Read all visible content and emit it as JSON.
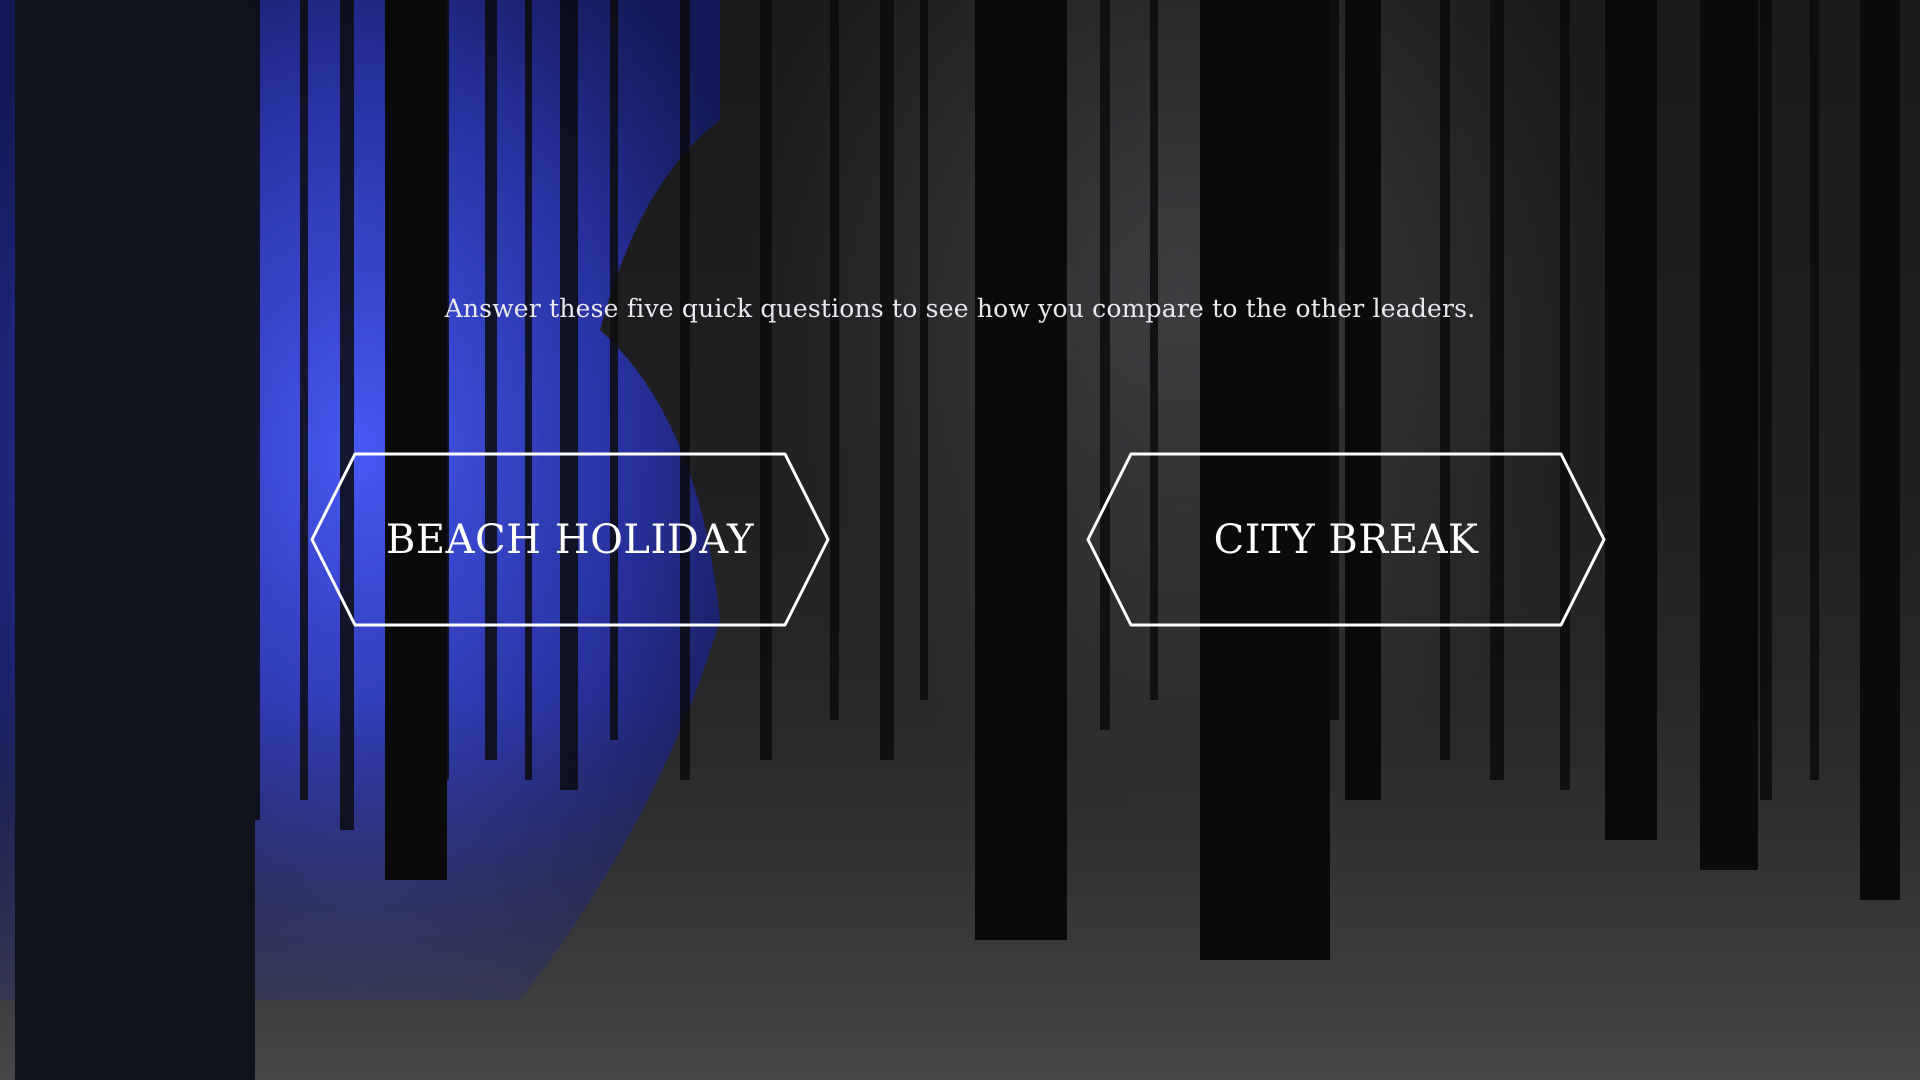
{
  "quiz": {
    "intro": "Answer these five quick questions to see how you compare to the other leaders.",
    "options": [
      {
        "label": "BEACH HOLIDAY"
      },
      {
        "label": "CITY BREAK"
      }
    ]
  },
  "colors": {
    "highlight_blue": "#3a4ce0",
    "text": "#ffffff",
    "background": "#1c1c1e"
  },
  "background": {
    "scene": "forest-background"
  }
}
